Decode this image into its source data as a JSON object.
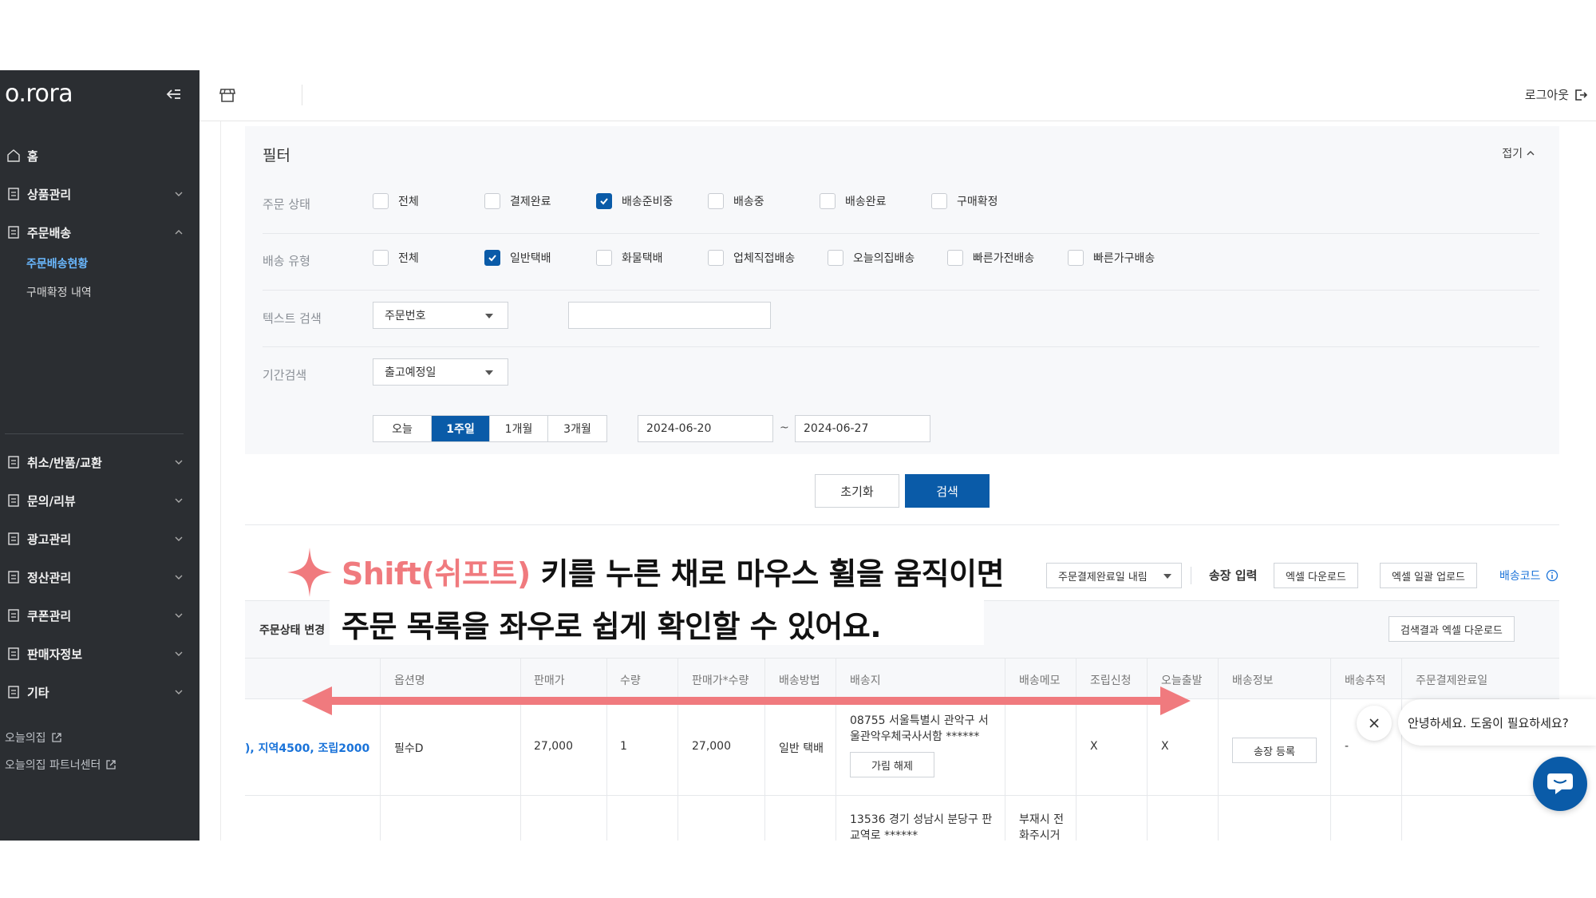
{
  "sidebar": {
    "logo": "o.rora",
    "items": [
      {
        "label": "홈"
      },
      {
        "label": "상품관리"
      },
      {
        "label": "주문배송"
      },
      {
        "label": "취소/반품/교환"
      },
      {
        "label": "문의/리뷰"
      },
      {
        "label": "광고관리"
      },
      {
        "label": "정산관리"
      },
      {
        "label": "쿠폰관리"
      },
      {
        "label": "판매자정보"
      },
      {
        "label": "기타"
      }
    ],
    "sub_items": [
      {
        "label": "주문배송현황",
        "active": true
      },
      {
        "label": "구매확정 내역"
      }
    ],
    "external_links": [
      {
        "label": "오늘의집"
      },
      {
        "label": "오늘의집 파트너센터"
      }
    ]
  },
  "topbar": {
    "logout_label": "로그아웃"
  },
  "filter": {
    "title": "필터",
    "fold_label": "접기",
    "order_status": {
      "label": "주문 상태",
      "options": [
        {
          "label": "전체",
          "checked": false
        },
        {
          "label": "결제완료",
          "checked": false
        },
        {
          "label": "배송준비중",
          "checked": true
        },
        {
          "label": "배송중",
          "checked": false
        },
        {
          "label": "배송완료",
          "checked": false
        },
        {
          "label": "구매확정",
          "checked": false
        }
      ]
    },
    "delivery_type": {
      "label": "배송 유형",
      "options": [
        {
          "label": "전체",
          "checked": false
        },
        {
          "label": "일반택배",
          "checked": true
        },
        {
          "label": "화물택배",
          "checked": false
        },
        {
          "label": "업체직접배송",
          "checked": false
        },
        {
          "label": "오늘의집배송",
          "checked": false
        },
        {
          "label": "빠른가전배송",
          "checked": false
        },
        {
          "label": "빠른가구배송",
          "checked": false
        }
      ]
    },
    "text_search": {
      "label": "텍스트 검색",
      "select_value": "주문번호",
      "input_value": ""
    },
    "period": {
      "label": "기간검색",
      "select_value": "출고예정일",
      "options": [
        "오늘",
        "1주일",
        "1개월",
        "3개월"
      ],
      "selected": "1주일",
      "start_date": "2024-06-20",
      "end_date": "2024-06-27",
      "separator": "~"
    },
    "reset_label": "초기화",
    "search_label": "검색"
  },
  "toolbar": {
    "sort_select": "주문결제완료일 내림",
    "invoice_label": "송장 입력",
    "excel_download": "엑셀 다운로드",
    "excel_upload": "엑셀 일괄 업로드",
    "delivery_code": "배송코드",
    "status_change_label": "주문상태 변경",
    "result_excel": "검색결과 엑셀 다운로드"
  },
  "table": {
    "headers": [
      "옵션명",
      "판매가",
      "수량",
      "판매가*수량",
      "배송방법",
      "배송지",
      "배송메모",
      "조립신청",
      "오늘출발",
      "배송정보",
      "배송추적",
      "주문결제완료일"
    ],
    "rows": [
      {
        "price_note": "), 지역4500, 조립2000",
        "option": "필수D",
        "price": "27,000",
        "qty": "1",
        "total": "27,000",
        "method": "일반 택배",
        "address_line1": "08755 서울특별시 관악구 서",
        "address_line2": "울관악우체국사서함 ******",
        "address_button": "가림 해제",
        "memo": "",
        "assembly": "X",
        "today": "X",
        "info_button": "송장 등록",
        "tracking": "-"
      },
      {
        "address_line1": "13536 경기 성남시 분당구 판",
        "address_line2": "교역로 ******",
        "memo_line1": "부재시 전",
        "memo_line2": "화주시거"
      }
    ]
  },
  "annotation": {
    "highlight": "Shift(쉬프트)",
    "line1_rest": " 키를 누른 채로 마우스 휠을 움직이면",
    "line2": "주문 목록을 좌우로 쉽게 확인할 수 있어요.",
    "color": "#f07a7e"
  },
  "chat": {
    "message": "안녕하세요. 도움이 필요하세요?"
  },
  "colors": {
    "primary": "#0a5ba8",
    "sidebar_bg": "#2b2e32",
    "link": "#1a73d9"
  }
}
